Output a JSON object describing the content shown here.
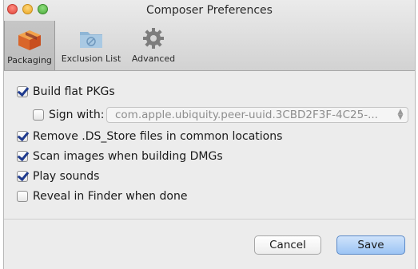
{
  "window": {
    "title": "Composer Preferences"
  },
  "toolbar": {
    "tabs": [
      {
        "label": "Packaging",
        "icon": "package-icon",
        "selected": true
      },
      {
        "label": "Exclusion List",
        "icon": "folder-icon",
        "selected": false
      },
      {
        "label": "Advanced",
        "icon": "gear-icon",
        "selected": false
      }
    ]
  },
  "options": {
    "build_flat_pkgs": {
      "label": "Build flat PKGs",
      "checked": true
    },
    "sign_with": {
      "label": "Sign with:",
      "checked": false,
      "value": "com.apple.ubiquity.peer-uuid.3CBD2F3F-4C25-..."
    },
    "remove_ds_store": {
      "label": "Remove .DS_Store files in common locations",
      "checked": true
    },
    "scan_images": {
      "label": "Scan images when building DMGs",
      "checked": true
    },
    "play_sounds": {
      "label": "Play sounds",
      "checked": true
    },
    "reveal_in_finder": {
      "label": "Reveal in Finder when done",
      "checked": false
    }
  },
  "buttons": {
    "cancel": "Cancel",
    "save": "Save"
  },
  "colors": {
    "accent": "#1f3b8e",
    "default_button": "#9cc4f4"
  }
}
